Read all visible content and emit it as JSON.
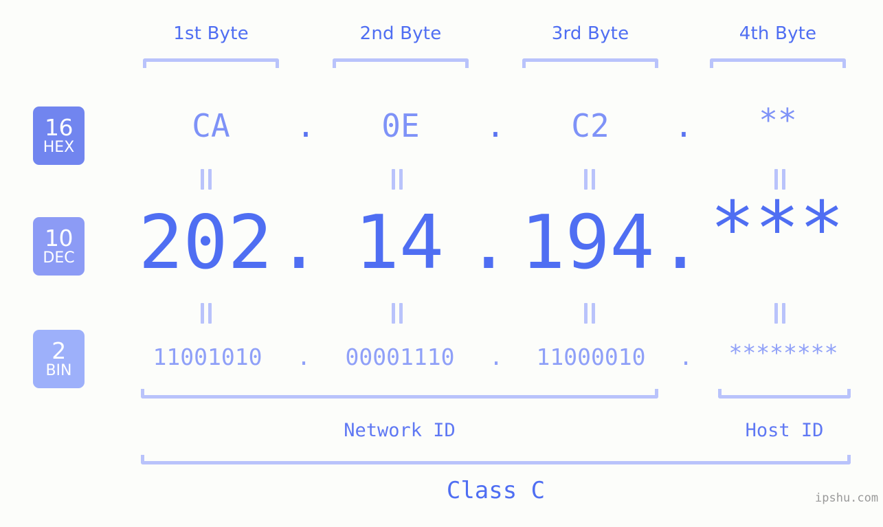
{
  "page": {
    "background_color": "#fcfdfa",
    "accent_color": "#4f6ef2",
    "light_accent_color": "#b9c3fb",
    "watermark": "ipshu.com"
  },
  "byte_headers": [
    {
      "label": "1st Byte"
    },
    {
      "label": "2nd Byte"
    },
    {
      "label": "3rd Byte"
    },
    {
      "label": "4th Byte"
    }
  ],
  "bases": [
    {
      "number": "16",
      "name": "HEX",
      "color": "#7185ef"
    },
    {
      "number": "10",
      "name": "DEC",
      "color": "#8c9bf5"
    },
    {
      "number": "2",
      "name": "BIN",
      "color": "#9db0fa"
    }
  ],
  "rows": {
    "hex": {
      "base_number": "16",
      "base_name": "HEX",
      "values": [
        "CA",
        "0E",
        "C2",
        "**"
      ],
      "separator": "."
    },
    "dec": {
      "base_number": "10",
      "base_name": "DEC",
      "values": [
        "202",
        "14",
        "194",
        "***"
      ],
      "separator": "."
    },
    "bin": {
      "base_number": "2",
      "base_name": "BIN",
      "values": [
        "11001010",
        "00001110",
        "11000010",
        "********"
      ],
      "separator": "."
    }
  },
  "equals_marker": "=",
  "sections": [
    {
      "label": "Network ID"
    },
    {
      "label": "Host ID"
    }
  ],
  "class": {
    "label": "Class C"
  }
}
